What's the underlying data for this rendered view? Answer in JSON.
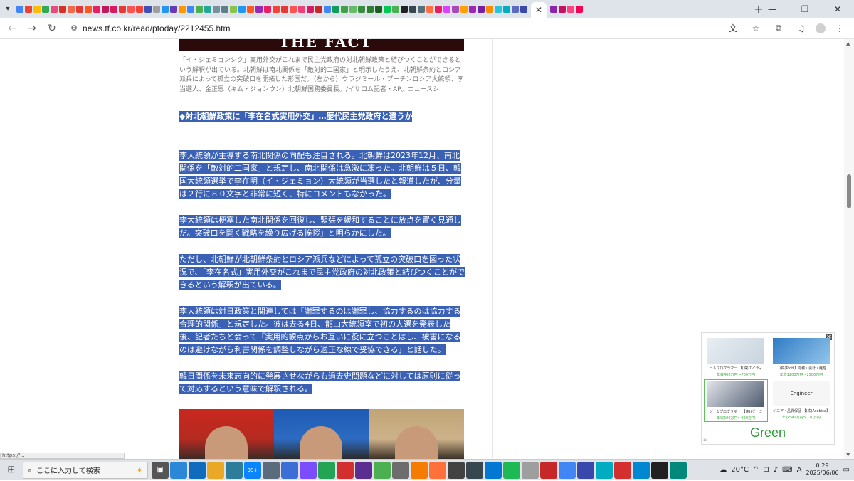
{
  "browser": {
    "url": "news.tf.co.kr/read/ptoday/2212455.htm",
    "tab_favicon_colors": [
      "#4285f4",
      "#ea4335",
      "#fbbc05",
      "#34a853",
      "#e84a7e",
      "#d93025",
      "#ee6a4a",
      "#e53935",
      "#ff5722",
      "#e91e63",
      "#c2185b",
      "#d81b60",
      "#e53935",
      "#ff5252",
      "#f44336",
      "#3f51b5",
      "#9e9e9e",
      "#2196f3",
      "#673ab7",
      "#ff9800",
      "#4285f4",
      "#4caf50",
      "#26a69a",
      "#78909c",
      "#607d8b",
      "#8bc34a",
      "#2196f3",
      "#ff5722",
      "#9c27b0",
      "#e91e63",
      "#f44336",
      "#e53935",
      "#ff5252",
      "#ec407a",
      "#d81b60",
      "#c62828",
      "#4285f4",
      "#0f9d58",
      "#43a047",
      "#66bb6a",
      "#388e3c",
      "#2e7d32",
      "#1b5e20",
      "#00c853",
      "#4caf50",
      "#212121",
      "#37474f",
      "#546e7a",
      "#ff7043",
      "#e91e63",
      "#e040fb",
      "#ab47bc",
      "#ffa000",
      "#9c27b0",
      "#7b1fa2",
      "#fb8c00",
      "#26c6da",
      "#00acc1",
      "#5c6bc0",
      "#3949ab",
      "#8e24aa",
      "#c51162",
      "#ff4081",
      "#f50057"
    ],
    "active_tab_close": "✕",
    "new_tab": "+",
    "window_controls": [
      "—",
      "❐",
      "✕"
    ]
  },
  "article": {
    "hero_lettering": "THE FACT",
    "caption": "「イ・ジェミョンシク」実用外交がこれまで民主党政府の対北朝鮮政策と結びつくことができるという解釈が出ている。北朝鮮は南北関係を「敵対的二国家」と明示したうえ、北朝鮮条約とロシア派兵によって孤立の突破口を開拓した形国だ。（左から）ウラジミール・プーチンロシア大統領、李当選人、金正恩（キム・ジョンウン）北朝鮮国務委員長。/イサロム記者・AP。ニュースシ",
    "subhead": "◆対北朝鮮政策に「李在名式実用外交」…歴代民主党政府と違うか",
    "paragraphs": [
      "李大統領が主導する南北関係の向配も注目される。北朝鮮は2023年12月、南北関係を「敵対的二国家」と規定し、南北関係は急激に凍った。北朝鮮は５日、韓国大統領選挙で李在明（イ・ジェミョン）大統領が当選したと報道したが、分量は２行に８０文字と非常に短く、特にコメントもなかった。",
      "李大統領は梗塞した南北関係を回復し、緊張を緩和することに放点を置く見通しだ。突破口を開く戦略を繰り広げる挨拶」と明らかにした。",
      "ただし、北朝鮮が北朝鮮条約とロシア派兵などによって孤立の突破口を図った状況で、「李在名式」実用外交がこれまで民主党政府の対北政策と結びつくことができるという解釈が出ている。",
      "李大統領は対日政策と関連しては「謝罪するのは謝罪し、協力するのは協力する合理的関係」と規定した。彼は去る4日、龍山大統領室で初の人選を発表した後、記者たちと会って「実用的観点からお互いに役に立つことはし、被害になるのは避けながら利害関係を調整しながら適正な線で妥協できる」と話した。",
      "韓日関係を未来志向的に発展させながらも過去史問題などに対しては原則に従って対応するという意味で解釈される。"
    ]
  },
  "ad": {
    "close": "✕",
    "cards": [
      {
        "title": "ームプログラマー 【(株)エイティ",
        "salary": "年収400万円〜700万円"
      },
      {
        "title": "【(株)Plott】財務・会計・経理",
        "salary": "年収1200万円〜2500万円"
      },
      {
        "title": "ゲームプログラマー 【(株)ゲーミ",
        "salary": "年収600万円〜960万円"
      },
      {
        "title": "ジニア・品質保証 【(株)Asobica】",
        "salary": "年収540万円〜720万円"
      }
    ],
    "card4_image_text": "Engineer",
    "logo": "Green",
    "info_icon": "≡"
  },
  "status_url": "https://...",
  "taskbar": {
    "search_placeholder": "ここに入力して検索",
    "app_icon_colors": [
      "#2b88d8",
      "#0f6cbd",
      "#e9a825",
      "#2d7d9a",
      "#0a84ff",
      "#5a6b7d",
      "#3c6fd6",
      "#7c4dff",
      "#23a455",
      "#d32f2f",
      "#5c2d91",
      "#4caf50",
      "#6d6d6d",
      "#f57c00",
      "#ff7139",
      "#424242",
      "#37474f",
      "#0078d4",
      "#1db954",
      "#9e9e9e",
      "#c62828",
      "#4285f4",
      "#3949ab",
      "#00acc1",
      "#d32f2f",
      "#0288d1",
      "#212121",
      "#00897b"
    ],
    "badge": "99+",
    "weather": "20°C",
    "ime": "A",
    "time": "0:29",
    "date": "2025/06/06"
  }
}
